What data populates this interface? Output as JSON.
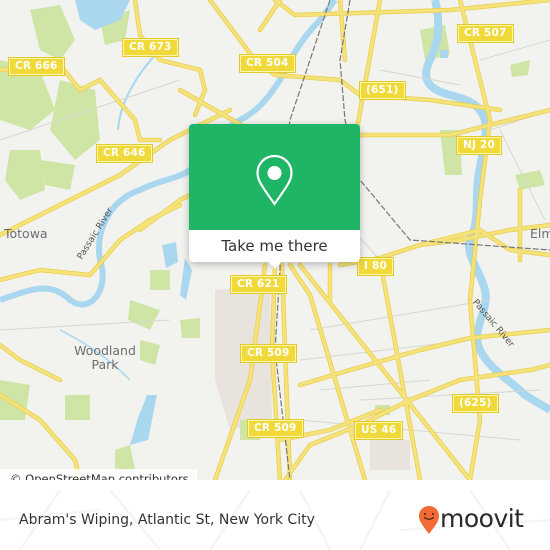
{
  "map": {
    "road_labels": [
      {
        "id": "cr-666",
        "text": "CR 666"
      },
      {
        "id": "cr-673",
        "text": "CR 673"
      },
      {
        "id": "cr-504",
        "text": "CR 504"
      },
      {
        "id": "cr-507",
        "text": "CR 507"
      },
      {
        "id": "r-651",
        "text": "(651)"
      },
      {
        "id": "cr-646",
        "text": "CR 646"
      },
      {
        "id": "nj-20",
        "text": "NJ 20"
      },
      {
        "id": "i-80",
        "text": "I 80"
      },
      {
        "id": "cr-621",
        "text": "CR 621"
      },
      {
        "id": "cr-509-a",
        "text": "CR 509"
      },
      {
        "id": "r-625",
        "text": "(625)"
      },
      {
        "id": "cr-509-b",
        "text": "CR 509"
      },
      {
        "id": "us-46",
        "text": "US 46"
      }
    ],
    "place_labels": {
      "totowa": "Totowa",
      "woodland_park_line1": "Woodland",
      "woodland_park_line2": "Park",
      "elmwood_park_partial": "Elm"
    },
    "river_labels": {
      "passaic_west": "Passaic River",
      "passaic_east": "Passaic River"
    },
    "colors": {
      "land": "#f2f2ef",
      "road": "#f6e27a",
      "road_casing": "#e8cf4c",
      "water": "#a9d7ef",
      "park": "#cfe5a6",
      "urban": "#e9e3de",
      "rail": "#777777"
    }
  },
  "popup": {
    "icon": "map-pin-icon",
    "cta_label": "Take me there",
    "accent_color": "#1fb566"
  },
  "attribution": {
    "text": "© OpenStreetMap contributors"
  },
  "footer": {
    "place_name": "Abram's Wiping, Atlantic St, New York City",
    "brand": {
      "name": "moovit",
      "icon": "moovit-logo-icon",
      "color": "#f26a36"
    }
  }
}
